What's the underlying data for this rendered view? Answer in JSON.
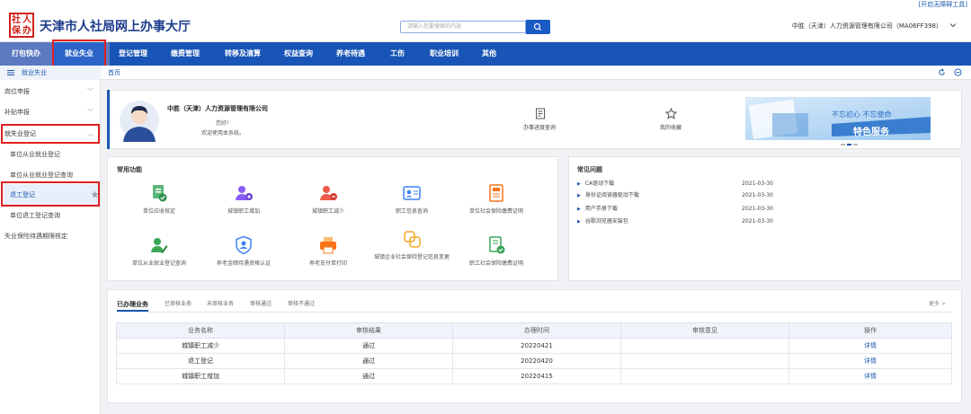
{
  "accessibility_link": "[开启无障碍工具]",
  "header": {
    "logo_chars": [
      "社",
      "人",
      "保",
      "办"
    ],
    "title": "天津市人社局网上办事大厅",
    "search_placeholder": "请输入您要搜索的内容",
    "company": "中胜（天津）人力资源管理有限公司（MA06FF398）"
  },
  "nav": {
    "items": [
      "打包快办",
      "就业失业",
      "登记管理",
      "缴费管理",
      "转移及清算",
      "权益查询",
      "养老待遇",
      "工伤",
      "职业培训",
      "其他"
    ],
    "active": "就业失业"
  },
  "sidebar": {
    "head": "就业失业",
    "items": [
      {
        "label": "岗位申报",
        "type": "group"
      },
      {
        "label": "补贴申报",
        "type": "group"
      },
      {
        "label": "就失业登记",
        "type": "group-open"
      },
      {
        "label": "单位从业就业登记",
        "type": "sub"
      },
      {
        "label": "单位从业就业登记查询",
        "type": "sub"
      },
      {
        "label": "退工登记",
        "type": "sub-active"
      },
      {
        "label": "单位退工登记查询",
        "type": "sub"
      },
      {
        "label": "失业保险待遇期限核定",
        "type": "group"
      }
    ]
  },
  "tabs": {
    "home": "首页"
  },
  "profile": {
    "company": "中胜（天津）人力资源管理有限公司",
    "hello": "您好!",
    "welcome": "欢迎使用本系统。",
    "quick1": "办事进度查询",
    "quick2": "我的收藏"
  },
  "banner": {
    "line1": "不忘初心  不忘使命",
    "line2": "特色服务"
  },
  "common": {
    "title": "常用功能",
    "items": [
      {
        "label": "单位应收核定",
        "icon": "doc-check-icon",
        "color": "#3aa657"
      },
      {
        "label": "城镇职工增加",
        "icon": "user-add-icon",
        "color": "#8b5cf6"
      },
      {
        "label": "城镇职工减少",
        "icon": "user-remove-icon",
        "color": "#ef5a4c"
      },
      {
        "label": "职工信息查询",
        "icon": "id-card-icon",
        "color": "#3b82f6"
      },
      {
        "label": "单位社会保险缴费证明",
        "icon": "certificate-icon",
        "color": "#f97316"
      },
      {
        "label": "单位从业就业登记查询",
        "icon": "user-edit-icon",
        "color": "#3aa657"
      },
      {
        "label": "养老金暗待遇资格认证",
        "icon": "shield-user-icon",
        "color": "#3b82f6"
      },
      {
        "label": "养老支付单打印",
        "icon": "printer-icon",
        "color": "#f97316"
      },
      {
        "label": "城镇企业社会保险登记信息变更",
        "icon": "exchange-icon",
        "color": "#f5a623"
      },
      {
        "label": "职工社会保险缴费证明",
        "icon": "doc-stamp-icon",
        "color": "#3aa657"
      }
    ]
  },
  "faq": {
    "title": "常见问题",
    "items": [
      {
        "label": "CA驱动下载",
        "date": "2021-03-30"
      },
      {
        "label": "身份证阅读器驱动下载",
        "date": "2021-03-30"
      },
      {
        "label": "用户手册下载",
        "date": "2021-03-30"
      },
      {
        "label": "谷歌浏览器安装包",
        "date": "2021-03-30"
      }
    ]
  },
  "business": {
    "tabs": [
      "已办理业务",
      "已审核业务",
      "未审核业务",
      "审核通过",
      "审核不通过"
    ],
    "more": "更多 >",
    "columns": [
      "业务名称",
      "审核结果",
      "办理时间",
      "审核意见",
      "操作"
    ],
    "rows": [
      {
        "name": "城镇职工减少",
        "result": "通过",
        "time": "20220421",
        "opinion": "",
        "op": "详情"
      },
      {
        "name": "退工登记",
        "result": "通过",
        "time": "20220420",
        "opinion": "",
        "op": "详情"
      },
      {
        "name": "城镇职工增加",
        "result": "通过",
        "time": "20220415",
        "opinion": "",
        "op": "详情"
      }
    ]
  },
  "colors": {
    "nav": "#1955b6",
    "accent": "#1a56b0",
    "highlight": "#e02020"
  }
}
